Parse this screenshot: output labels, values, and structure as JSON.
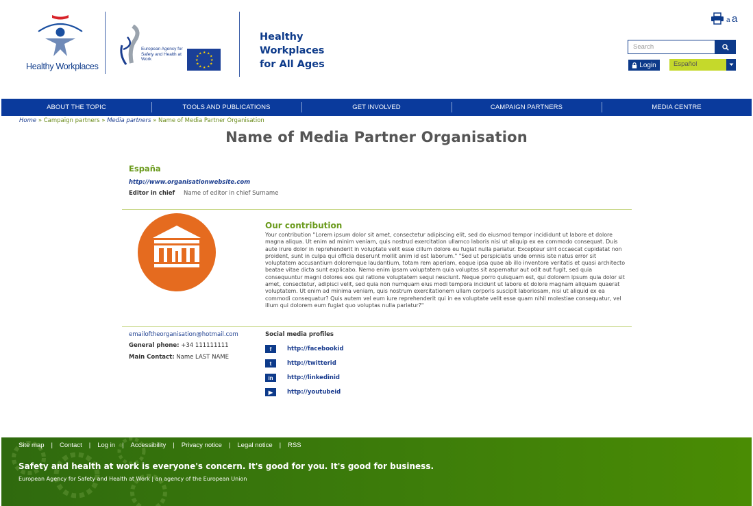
{
  "header": {
    "hw_logo_text": "Healthy Workplaces",
    "agency_logo_text": "European Agency for Safety and Health at Work",
    "campaign_line1": "Healthy",
    "campaign_line2": "Workplaces",
    "campaign_line3": "for All Ages",
    "font_small": "a",
    "font_large": "a",
    "search_placeholder": "Search",
    "login_label": "Login",
    "language": "Español"
  },
  "nav": [
    {
      "label": "ABOUT THE TOPIC"
    },
    {
      "label": "TOOLS AND PUBLICATIONS"
    },
    {
      "label": "GET INVOLVED"
    },
    {
      "label": "CAMPAIGN PARTNERS"
    },
    {
      "label": "MEDIA CENTRE"
    }
  ],
  "breadcrumb": {
    "home": "Home",
    "sep": "»",
    "campaign_partners": "Campaign partners",
    "media_partners": "Media partners",
    "current": "Name of Media Partner Organisation"
  },
  "page": {
    "title": "Name of Media Partner Organisation",
    "country": "España",
    "website": "http://www.organisationwebsite.com",
    "editor_label": "Editor in chief",
    "editor_value": "Name of editor in chief Surname",
    "contribution_title": "Our contribution",
    "contribution_text": "Your contribution \"Lorem ipsum dolor sit amet, consectetur adipiscing elit, sed do eiusmod tempor incididunt ut labore et dolore magna aliqua. Ut enim ad minim veniam, quis nostrud exercitation ullamco laboris nisi ut aliquip ex ea commodo consequat. Duis aute irure dolor in reprehenderit in voluptate velit esse cillum dolore eu fugiat nulla pariatur. Excepteur sint occaecat cupidatat non proident, sunt in culpa qui officia deserunt mollit anim id est laborum.\" \"Sed ut perspiciatis unde omnis iste natus error sit voluptatem accusantium doloremque laudantium, totam rem aperiam, eaque ipsa quae ab illo inventore veritatis et quasi architecto beatae vitae dicta sunt explicabo. Nemo enim ipsam voluptatem quia voluptas sit aspernatur aut odit aut fugit, sed quia consequuntur magni dolores eos qui ratione voluptatem sequi nesciunt. Neque porro quisquam est, qui dolorem ipsum quia dolor sit amet, consectetur, adipisci velit, sed quia non numquam eius modi tempora incidunt ut labore et dolore magnam aliquam quaerat voluptatem. Ut enim ad minima veniam, quis nostrum exercitationem ullam corporis suscipit laboriosam, nisi ut aliquid ex ea commodi consequatur? Quis autem vel eum iure reprehenderit qui in ea voluptate velit esse quam nihil molestiae consequatur, vel illum qui dolorem eum fugiat quo voluptas nulla pariatur?\"",
    "email": "emailoftheorganisation@hotmail.com",
    "phone_label": "General phone:",
    "phone_value": "+34 111111111",
    "contact_label": "Main Contact:",
    "contact_value": "Name LAST NAME",
    "social_title": "Social media profiles",
    "social": [
      {
        "icon": "facebook-icon",
        "glyph": "f",
        "url": "http://facebookid"
      },
      {
        "icon": "twitter-icon",
        "glyph": "t",
        "url": "http://twitterid"
      },
      {
        "icon": "linkedin-icon",
        "glyph": "in",
        "url": "http://linkedinid"
      },
      {
        "icon": "youtube-icon",
        "glyph": "▶",
        "url": "http://youtubeid"
      }
    ]
  },
  "footer": {
    "links": [
      "Site map",
      "Contact",
      "Log in",
      "Accessibility",
      "Privacy notice",
      "Legal notice",
      "RSS"
    ],
    "separator": "|",
    "slogan": "Safety and health at work is everyone's concern. It's good for you. It's good for business.",
    "agency": "European Agency for Safety and Health at Work | an agency of the European Union"
  },
  "colors": {
    "brand_blue": "#0a3a9c",
    "accent_green": "#6a9a1c",
    "lang_green": "#c5d92b",
    "org_logo_orange": "#e56b1f",
    "footer_green": "#3d7d0a"
  }
}
